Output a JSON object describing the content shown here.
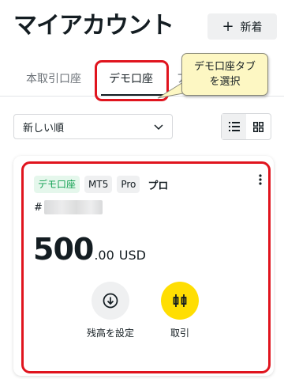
{
  "header": {
    "title": "マイアカウント",
    "new_button_label": "新着",
    "new_button_icon": "plus-icon"
  },
  "tabs": {
    "real_label": "本取引口座",
    "demo_label": "デモ口座",
    "partial_label": "ア"
  },
  "callout": {
    "line1": "デモ口座タブ",
    "line2": "を選択"
  },
  "toolbar": {
    "sort_value": "新しい順",
    "sort_icon": "chevron-down-icon",
    "list_view_icon": "list-icon",
    "grid_view_icon": "grid-icon"
  },
  "account": {
    "badge_demo": "デモ口座",
    "badge_platform": "MT5",
    "badge_type": "Pro",
    "badge_plain": "プロ",
    "number_prefix": "#",
    "balance_int": "500",
    "balance_dec": ".00",
    "currency": "USD",
    "actions": [
      {
        "label": "残高を設定",
        "icon": "download-icon"
      },
      {
        "label": "取引",
        "icon": "candlestick-icon"
      }
    ]
  },
  "colors": {
    "highlight": "#e0141e",
    "accent_yellow": "#ffde02",
    "demo_green": "#0e9f4f",
    "callout_bg": "#fdf7c3"
  }
}
